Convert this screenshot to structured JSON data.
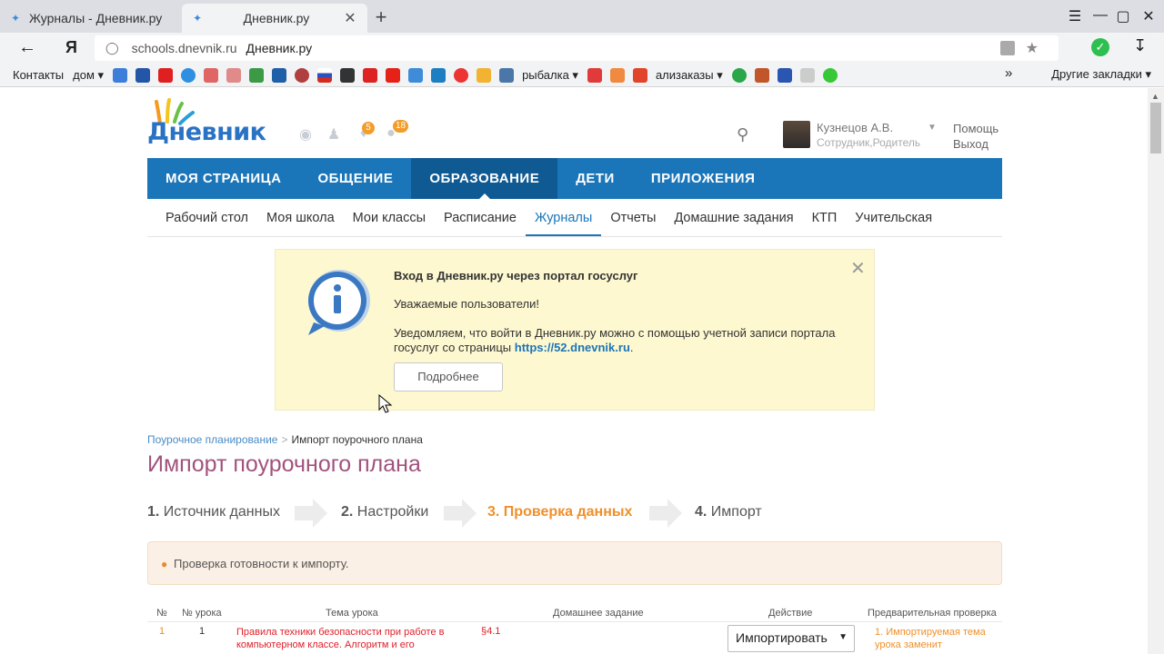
{
  "browser": {
    "tabs": [
      {
        "title": "Журналы - Дневник.ру",
        "active": false
      },
      {
        "title": "Дневник.ру",
        "active": true
      }
    ],
    "new_tab": "+",
    "address": {
      "host": "schools.dnevnik.ru",
      "page_title": "Дневник.ру"
    },
    "bookmarks": [
      "Контакты",
      "дом",
      "рыбалка",
      "ализаказы"
    ],
    "bookmarks_other": "Другие закладки",
    "bookmark_more": "»"
  },
  "header": {
    "logo_text": "Дневник",
    "notifications_count": "5",
    "friends_count": "18",
    "user": {
      "name": "Кузнецов А.В.",
      "role": "Сотрудник,Родитель"
    },
    "help": "Помощь",
    "logout": "Выход"
  },
  "main_nav": [
    "МОЯ СТРАНИЦА",
    "ОБЩЕНИЕ",
    "ОБРАЗОВАНИЕ",
    "ДЕТИ",
    "ПРИЛОЖЕНИЯ"
  ],
  "main_nav_active": "ОБРАЗОВАНИЕ",
  "sub_nav": [
    "Рабочий стол",
    "Моя школа",
    "Мои классы",
    "Расписание",
    "Журналы",
    "Отчеты",
    "Домашние задания",
    "КТП",
    "Учительская"
  ],
  "sub_nav_active": "Журналы",
  "notice": {
    "title": "Вход в Дневник.ру через портал госуслуг",
    "greeting": "Уважаемые пользователи!",
    "body": "Уведомляем, что войти в Дневник.ру можно с помощью учетной записи портала госуслуг со страницы",
    "link": "https://52.dnevnik.ru",
    "body_end": ".",
    "button": "Подробнее"
  },
  "breadcrumb": {
    "parent": "Поурочное планирование",
    "separator": ">",
    "current": "Импорт поурочного плана"
  },
  "page_title": "Импорт поурочного плана",
  "steps": [
    {
      "num": "1.",
      "label": "Источник данных"
    },
    {
      "num": "2.",
      "label": "Настройки"
    },
    {
      "num": "3.",
      "label": "Проверка данных"
    },
    {
      "num": "4.",
      "label": "Импорт"
    }
  ],
  "current_step": 3,
  "check_message": "Проверка готовности к импорту.",
  "table": {
    "headers": [
      "№",
      "№ урока",
      "Тема урока",
      "Домашнее задание",
      "Действие",
      "Предварительная проверка"
    ],
    "rows": [
      {
        "num": "1",
        "lesson": "1",
        "topic": "Правила техники безопасности при работе в компьютерном классе. Алгоритм и его",
        "homework": "§4.1",
        "action": "Импортировать",
        "precheck": "1. Импортируемая тема урока заменит"
      }
    ]
  },
  "colors": {
    "nav_blue": "#1b75b9",
    "title_purple": "#a1527e",
    "accent_orange": "#f0902a",
    "notice_yellow": "#fdf8d0"
  }
}
